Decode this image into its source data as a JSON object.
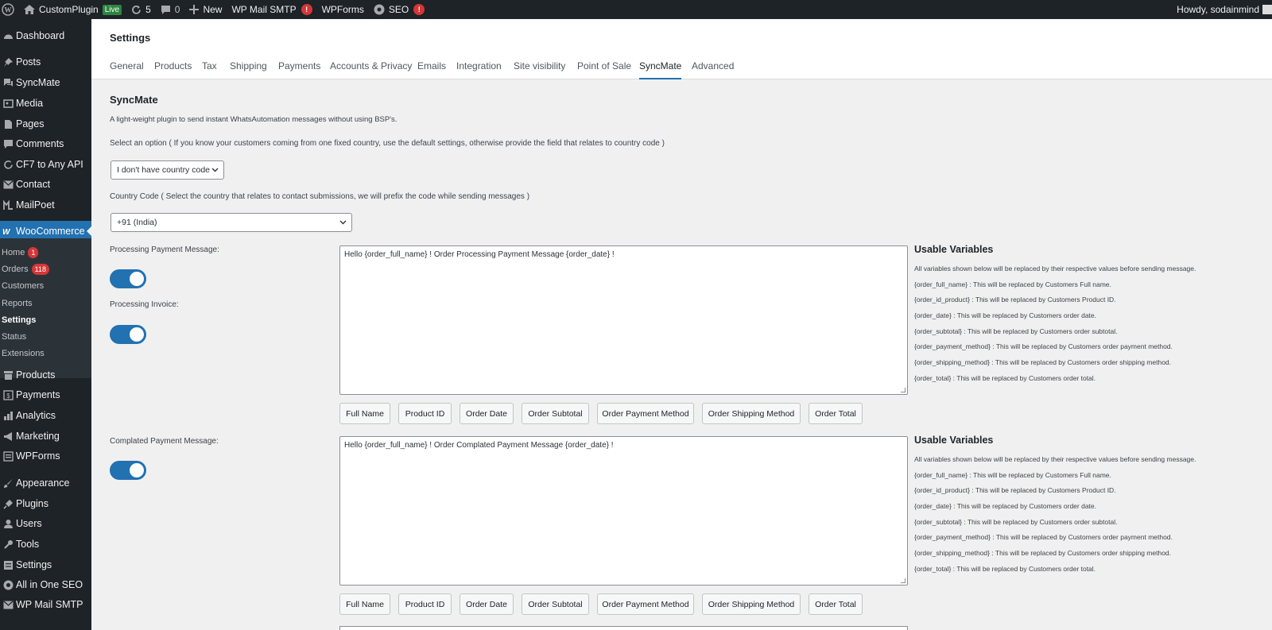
{
  "admin_bar": {
    "site_name": "CustomPlugin",
    "live_label": "Live",
    "updates_count": "5",
    "comments_count": "0",
    "new_label": "New",
    "wp_mail_smtp_label": "WP Mail SMTP",
    "wp_mail_smtp_badge": "!",
    "wpforms_label": "WPForms",
    "seo_label": "SEO",
    "seo_badge": "!",
    "greeting": "Howdy, sodainmind"
  },
  "sidebar": {
    "items": [
      {
        "label": "Dashboard",
        "icon": "dashboard-icon"
      },
      {
        "label": "Posts",
        "icon": "pin-icon"
      },
      {
        "label": "SyncMate",
        "icon": "chat-icon"
      },
      {
        "label": "Media",
        "icon": "media-icon"
      },
      {
        "label": "Pages",
        "icon": "page-icon"
      },
      {
        "label": "Comments",
        "icon": "comment-icon"
      },
      {
        "label": "CF7 to Any API",
        "icon": "refresh-icon"
      },
      {
        "label": "Contact",
        "icon": "mail-icon"
      },
      {
        "label": "MailPoet",
        "icon": "mailpoet-icon"
      },
      {
        "label": "WooCommerce",
        "icon": "woo-icon"
      },
      {
        "label": "Products",
        "icon": "archive-icon"
      },
      {
        "label": "Payments",
        "icon": "dollar-icon"
      },
      {
        "label": "Analytics",
        "icon": "bar-chart-icon"
      },
      {
        "label": "Marketing",
        "icon": "megaphone-icon"
      },
      {
        "label": "WPForms",
        "icon": "form-icon"
      },
      {
        "label": "Appearance",
        "icon": "brush-icon"
      },
      {
        "label": "Plugins",
        "icon": "plug-icon"
      },
      {
        "label": "Users",
        "icon": "user-icon"
      },
      {
        "label": "Tools",
        "icon": "wrench-icon"
      },
      {
        "label": "Settings",
        "icon": "settings-icon"
      },
      {
        "label": "All in One SEO",
        "icon": "seo-icon"
      },
      {
        "label": "WP Mail SMTP",
        "icon": "envelope-icon"
      }
    ],
    "submenu": [
      {
        "label": "Home",
        "badge": "1"
      },
      {
        "label": "Orders",
        "badge": "118"
      },
      {
        "label": "Customers",
        "badge": ""
      },
      {
        "label": "Reports",
        "badge": ""
      },
      {
        "label": "Settings",
        "badge": ""
      },
      {
        "label": "Status",
        "badge": ""
      },
      {
        "label": "Extensions",
        "badge": ""
      }
    ]
  },
  "header": {
    "title": "Settings",
    "tabs": [
      "General",
      "Products",
      "Tax",
      "Shipping",
      "Payments",
      "Accounts & Privacy",
      "Emails",
      "Integration",
      "Site visibility",
      "Point of Sale",
      "SyncMate",
      "Advanced"
    ],
    "active_tab": "SyncMate"
  },
  "main": {
    "section_title": "SyncMate",
    "description": "A light-weight plugin to send instant WhatsAutomation messages without using BSP's.",
    "option_label": "Select an option ( If you know your customers coming from one fixed country, use the default settings, otherwise provide the field that relates to country code )",
    "option_value": "I don't have country code",
    "country_label": "Country Code ( Select the country that relates to contact submissions, we will prefix the code while sending messages )",
    "country_value": "+91 (India)",
    "processing_payment_label": "Processing Payment Message:",
    "processing_invoice_label": "Processing Invoice:",
    "processing_message": "Hello {order_full_name} ! Order Processing Payment Message {order_date} !",
    "completed_payment_label": "Complated Payment Message:",
    "completed_message": "Hello {order_full_name} ! Order Complated Payment Message {order_date} !",
    "variable_buttons": [
      "Full Name",
      "Product ID",
      "Order Date",
      "Order Subtotal",
      "Order Payment Method",
      "Order Shipping Method",
      "Order Total"
    ],
    "usable_variables": {
      "title": "Usable Variables",
      "lines": [
        "All variables shown below will be replaced by their respective values before sending message.",
        "{order_full_name} : This will be replaced by Customers Full name.",
        "{order_id_product} : This will be replaced by Customers Product ID.",
        "{order_date} : This will be replaced by Customers order date.",
        "{order_subtotal} : This will be replaced by Customers order subtotal.",
        "{order_payment_method} : This will be replaced by Customers order payment method.",
        "{order_shipping_method} : This will be replaced by Customers order shipping method.",
        "{order_total} : This will be replaced by Customers order total."
      ]
    },
    "toggles": {
      "processing_payment": true,
      "processing_invoice": true,
      "completed_payment": true
    }
  },
  "colors": {
    "accent": "#2271b1",
    "admin_bg": "#1d2327",
    "badge": "#d63638",
    "live": "#2e8540"
  }
}
